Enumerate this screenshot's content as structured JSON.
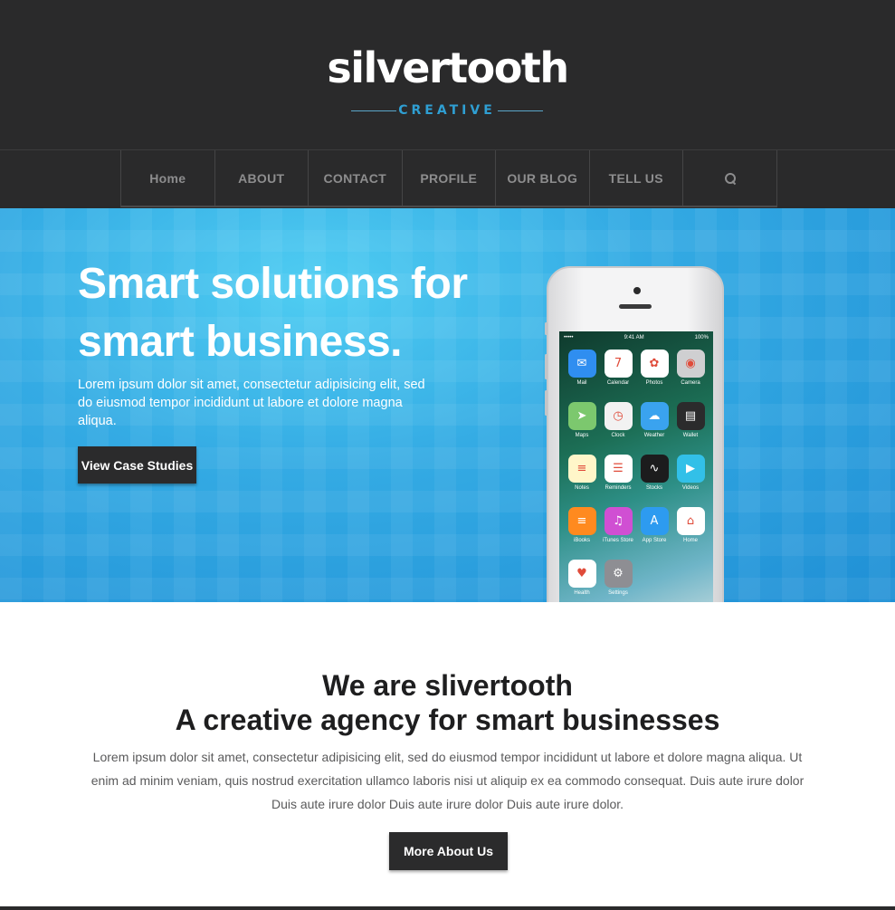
{
  "brand": {
    "name": "silvertooth",
    "tagline": "CREATIVE"
  },
  "nav": {
    "items": [
      "Home",
      "ABOUT",
      "CONTACT",
      "PROFILE",
      "OUR BLOG",
      "TELL US"
    ],
    "search_icon": "search-icon"
  },
  "hero": {
    "title_line1": "Smart solutions for",
    "title_line2": "smart business.",
    "description": "Lorem ipsum dolor sit amet, consectetur adipisicing elit, sed do eiusmod tempor incididunt ut labore et dolore magna aliqua.",
    "button_label": "View Case Studies"
  },
  "phone": {
    "time": "9:41 AM",
    "carrier": "•••••",
    "battery": "100%",
    "apps": [
      {
        "label": "Mail",
        "icon": "mail-icon",
        "glyph": "✉",
        "color": "#2f8ef0"
      },
      {
        "label": "Calendar",
        "icon": "calendar-icon",
        "glyph": "7",
        "color": "#ffffff"
      },
      {
        "label": "Photos",
        "icon": "photos-icon",
        "glyph": "✿",
        "color": "#ffffff"
      },
      {
        "label": "Camera",
        "icon": "camera-icon",
        "glyph": "◉",
        "color": "#cfcfd1"
      },
      {
        "label": "Maps",
        "icon": "maps-icon",
        "glyph": "➤",
        "color": "#7cc86e"
      },
      {
        "label": "Clock",
        "icon": "clock-icon",
        "glyph": "◷",
        "color": "#f2f2f2"
      },
      {
        "label": "Weather",
        "icon": "weather-icon",
        "glyph": "☁",
        "color": "#3aa3ef"
      },
      {
        "label": "Wallet",
        "icon": "wallet-icon",
        "glyph": "▤",
        "color": "#2b2b2c"
      },
      {
        "label": "Notes",
        "icon": "notes-icon",
        "glyph": "≡",
        "color": "#fff6c9"
      },
      {
        "label": "Reminders",
        "icon": "reminders-icon",
        "glyph": "☰",
        "color": "#ffffff"
      },
      {
        "label": "Stocks",
        "icon": "stocks-icon",
        "glyph": "∿",
        "color": "#1c1c1d"
      },
      {
        "label": "Videos",
        "icon": "videos-icon",
        "glyph": "▶",
        "color": "#32c0e8"
      },
      {
        "label": "iBooks",
        "icon": "ibooks-icon",
        "glyph": "≡",
        "color": "#ff8a1f"
      },
      {
        "label": "iTunes Store",
        "icon": "itunes-icon",
        "glyph": "♫",
        "color": "#d04fd3"
      },
      {
        "label": "App Store",
        "icon": "appstore-icon",
        "glyph": "A",
        "color": "#2d9bf0"
      },
      {
        "label": "Home",
        "icon": "home-icon",
        "glyph": "⌂",
        "color": "#ffffff"
      },
      {
        "label": "Health",
        "icon": "health-icon",
        "glyph": "♥",
        "color": "#ffffff"
      },
      {
        "label": "Settings",
        "icon": "settings-icon",
        "glyph": "⚙",
        "color": "#8e8e93"
      }
    ]
  },
  "about": {
    "heading_line1": "We are slivertooth",
    "heading_line2": "A creative agency for smart businesses",
    "text": "Lorem ipsum dolor sit amet, consectetur adipisicing elit, sed do eiusmod tempor incididunt ut labore et dolore magna aliqua. Ut enim ad minim veniam, quis nostrud exercitation ullamco laboris nisi ut aliquip ex ea commodo consequat. Duis aute irure dolor Duis aute irure dolor Duis aute irure dolor Duis aute irure dolor.",
    "button_label": "More About Us"
  },
  "colors": {
    "header_bg": "#2a2a2b",
    "accent": "#2f9fd3",
    "hero_blue": "#34abe4",
    "button_dark": "#2b2b2c"
  }
}
